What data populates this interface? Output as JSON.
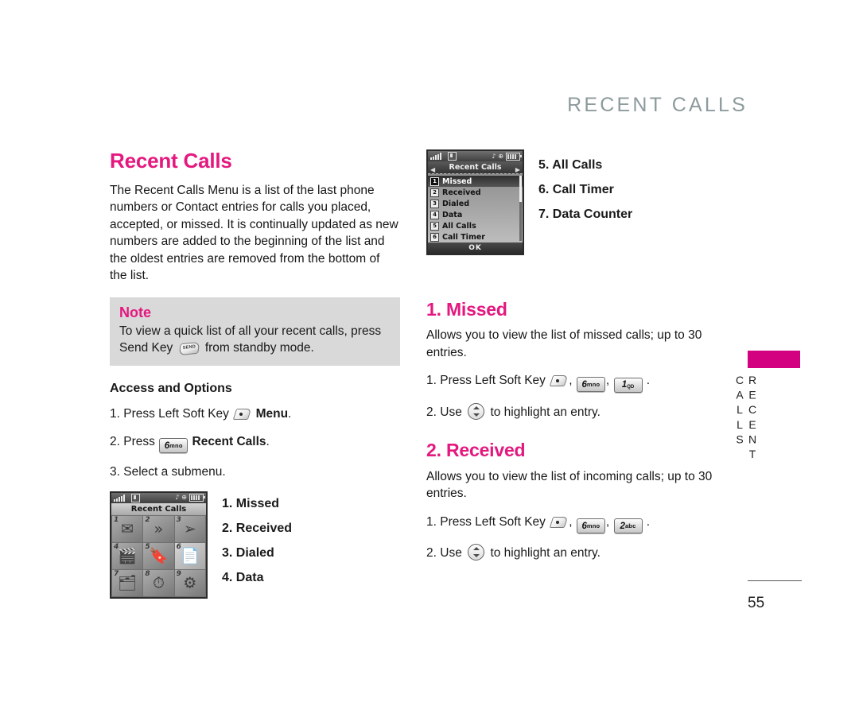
{
  "header": {
    "running_title": "RECENT CALLS"
  },
  "left": {
    "title": "Recent Calls",
    "intro": "The Recent Calls Menu is a list of the last phone numbers or Contact entries for calls you placed, accepted, or missed. It is continually updated as new numbers are added to the beginning of the list and the oldest entries are removed from the bottom of the list.",
    "note": {
      "label": "Note",
      "text_before": "To view a quick list of all your recent calls, press Send Key",
      "text_after": "from standby mode.",
      "send_key_label": "SEND"
    },
    "access_heading": "Access and Options",
    "steps": [
      {
        "num": "1.",
        "text_before": "Press Left Soft Key",
        "icon": "soft-key-icon",
        "text_after": "Menu",
        "bold_after": true,
        "period": "."
      },
      {
        "num": "2.",
        "text_before": "Press",
        "key": "6",
        "key_sub": "mno",
        "text_after": "Recent Calls",
        "bold_after": true,
        "period": "."
      },
      {
        "num": "3.",
        "text_before": "Select a submenu.",
        "text_after": "",
        "period": ""
      }
    ],
    "grid_screen": {
      "title": "Recent Calls",
      "cells": [
        {
          "idx": "1",
          "glyph": "✉",
          "highlight": false
        },
        {
          "idx": "2",
          "glyph": "»",
          "highlight": false
        },
        {
          "idx": "3",
          "glyph": "➢",
          "highlight": false
        },
        {
          "idx": "4",
          "glyph": "🎬",
          "highlight": false
        },
        {
          "idx": "5",
          "glyph": "🔖",
          "highlight": false
        },
        {
          "idx": "6",
          "glyph": "📄",
          "highlight": true
        },
        {
          "idx": "7",
          "glyph": "🗂",
          "highlight": false
        },
        {
          "idx": "8",
          "glyph": "⏱",
          "highlight": false
        },
        {
          "idx": "9",
          "glyph": "⚙",
          "highlight": false
        }
      ]
    },
    "menu_items_1_4": [
      "1. Missed",
      "2. Received",
      "3. Dialed",
      "4. Data"
    ]
  },
  "right": {
    "list_screen": {
      "title": "Recent Calls",
      "softkey": "OK",
      "items": [
        {
          "num": "1",
          "label": "Missed",
          "selected": true
        },
        {
          "num": "2",
          "label": "Received",
          "selected": false
        },
        {
          "num": "3",
          "label": "Dialed",
          "selected": false
        },
        {
          "num": "4",
          "label": "Data",
          "selected": false
        },
        {
          "num": "5",
          "label": "All Calls",
          "selected": false
        },
        {
          "num": "6",
          "label": "Call Timer",
          "selected": false
        }
      ]
    },
    "menu_items_5_7": [
      "5. All Calls",
      "6. Call Timer",
      "7.  Data Counter"
    ],
    "sections": [
      {
        "title": "1. Missed",
        "body": "Allows you to view the list of missed calls; up to 30 entries.",
        "step1_before": "Press Left Soft Key",
        "step1_keys": [
          {
            "main": "6",
            "sup": "mno"
          },
          {
            "main": "1",
            "sup": "",
            "sub": "QD"
          }
        ],
        "step1_num": "1.",
        "step2_num": "2.",
        "step2_before": "Use",
        "step2_after": "to highlight an entry."
      },
      {
        "title": "2. Received",
        "body": "Allows you to view the list of incoming calls; up to 30 entries.",
        "step1_before": "Press Left Soft Key",
        "step1_keys": [
          {
            "main": "6",
            "sup": "mno"
          },
          {
            "main": "2",
            "sup": "abc",
            "sub": ""
          }
        ],
        "step1_num": "1.",
        "step2_num": "2.",
        "step2_before": "Use",
        "step2_after": "to highlight an entry."
      }
    ]
  },
  "side_tab": {
    "text": "RECENT CALLS",
    "color": "#d3007f"
  },
  "footer": {
    "page_number": "55"
  }
}
